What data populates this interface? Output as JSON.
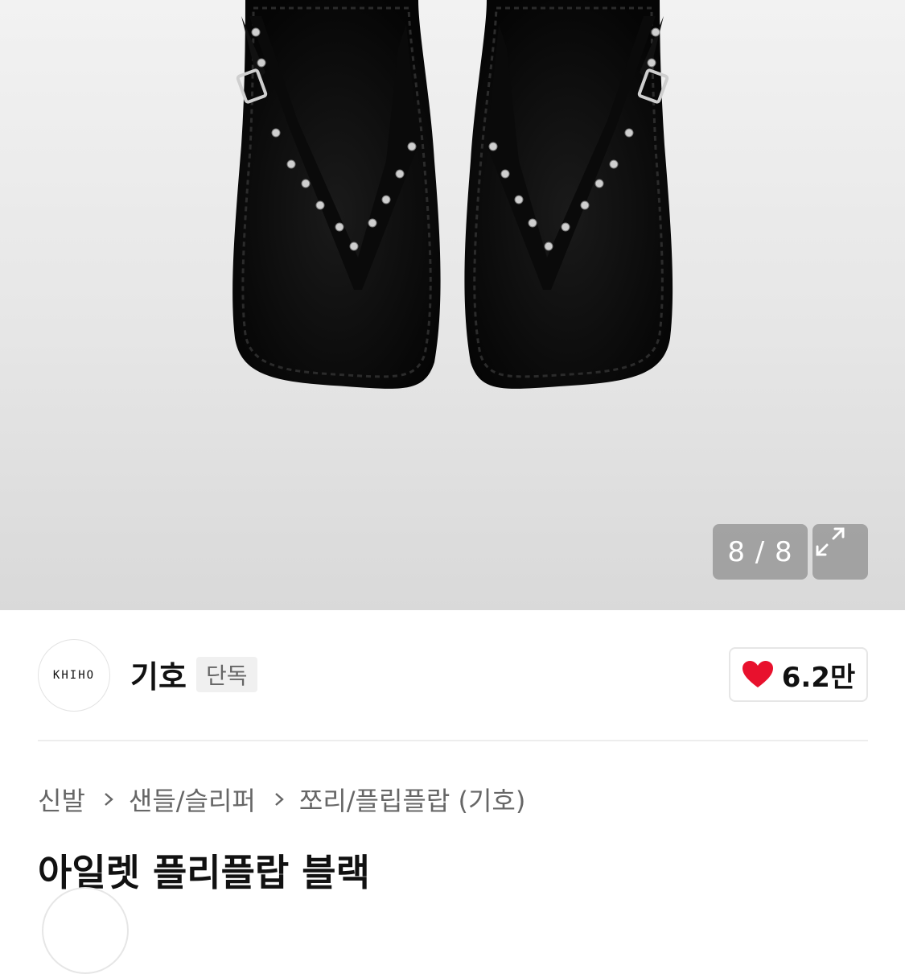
{
  "gallery": {
    "counter": "8 / 8",
    "image_subject": "black flip-flop sandals with eyelets",
    "expand_icon": "expand-icon"
  },
  "brand": {
    "logo_text": "KHIHO",
    "name": "기호",
    "badge": "단독",
    "like_count": "6.2만",
    "heart_color": "#e8112d"
  },
  "breadcrumb": [
    "신발",
    "샌들/슬리퍼",
    "쪼리/플립플랍 (기호)"
  ],
  "product": {
    "title": "아일렛 플리플랍 블랙"
  }
}
